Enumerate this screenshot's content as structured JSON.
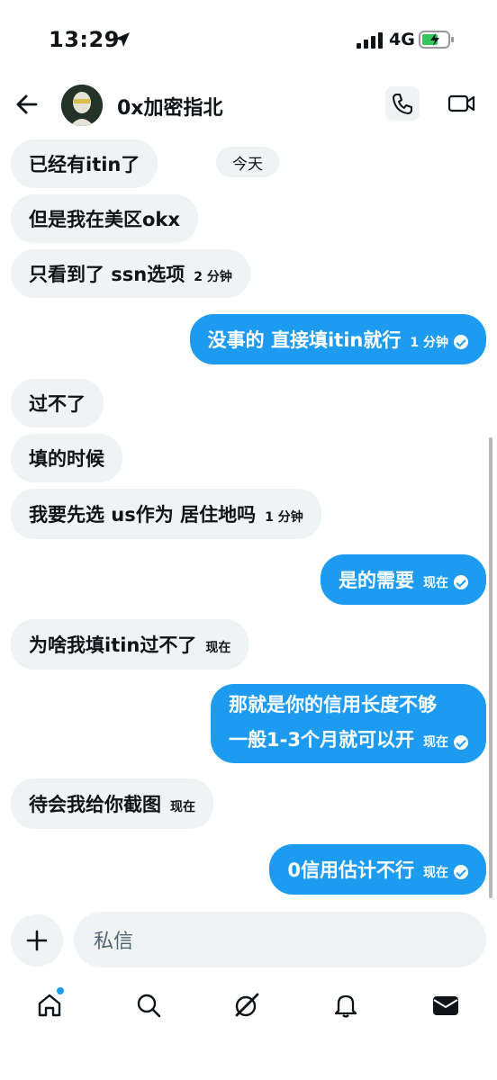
{
  "status": {
    "time": "13:29",
    "network": "4G"
  },
  "header": {
    "title": "0x加密指北"
  },
  "date_label": "今天",
  "messages": [
    {
      "dir": "in",
      "text": "已经有itin了"
    },
    {
      "dir": "in",
      "text": "但是我在美区okx"
    },
    {
      "dir": "in",
      "text": "只看到了 ssn选项",
      "time": "2 分钟"
    },
    {
      "dir": "out",
      "text": "没事的 直接填itin就行",
      "time": "1 分钟"
    },
    {
      "dir": "in",
      "text": "过不了"
    },
    {
      "dir": "in",
      "text": "填的时候"
    },
    {
      "dir": "in",
      "text": "我要先选 us作为 居住地吗",
      "time": "1 分钟"
    },
    {
      "dir": "out",
      "text": "是的需要",
      "time": "现在"
    },
    {
      "dir": "in",
      "text": "为啥我填itin过不了",
      "time": "现在"
    },
    {
      "dir": "out",
      "line1": "那就是你的信用长度不够",
      "line2": "一般1-3个月就可以开",
      "time": "现在"
    },
    {
      "dir": "in",
      "text": "待会我给你截图",
      "time": "现在"
    },
    {
      "dir": "out",
      "text": "0信用估计不行",
      "time": "现在"
    }
  ],
  "compose": {
    "placeholder": "私信"
  },
  "nav": [
    "home-icon",
    "search-icon",
    "grok-icon",
    "notifications-icon",
    "messages-icon"
  ],
  "colors": {
    "accent": "#1d9bf0",
    "incoming_bg": "#eff3f4",
    "text": "#0f1419"
  }
}
